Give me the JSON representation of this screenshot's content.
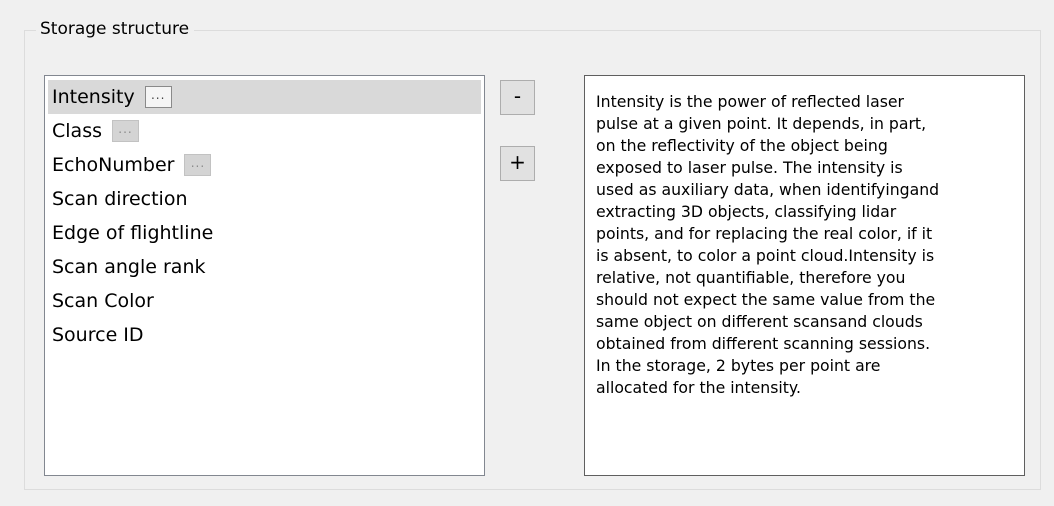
{
  "group": {
    "title": "Storage structure"
  },
  "list": {
    "items": [
      {
        "label": "Intensity",
        "ellipsis": "...",
        "selected": true
      },
      {
        "label": "Class",
        "ellipsis": "..."
      },
      {
        "label": "EchoNumber",
        "ellipsis": "..."
      },
      {
        "label": "Scan direction"
      },
      {
        "label": "Edge of flightline"
      },
      {
        "label": "Scan angle rank"
      },
      {
        "label": "Scan Color"
      },
      {
        "label": "Source ID"
      }
    ]
  },
  "buttons": {
    "remove_label": "-",
    "add_label": "+"
  },
  "description": {
    "lines": [
      "Intensity is the power of reflected laser",
      "pulse at a given point. It depends, in part,",
      "on the reflectivity of the object being",
      "exposed to laser pulse. The intensity is",
      "used as auxiliary data, when identifyingand",
      "extracting 3D objects, classifying lidar",
      "points, and for replacing the real color, if it",
      "is absent, to color a point cloud.Intensity is",
      "relative, not quantifiable, therefore you",
      "should not expect the same value from the",
      "same object on different scansand clouds",
      "obtained from different scanning sessions.",
      "In the storage, 2 bytes per point are",
      "allocated for the intensity."
    ]
  }
}
